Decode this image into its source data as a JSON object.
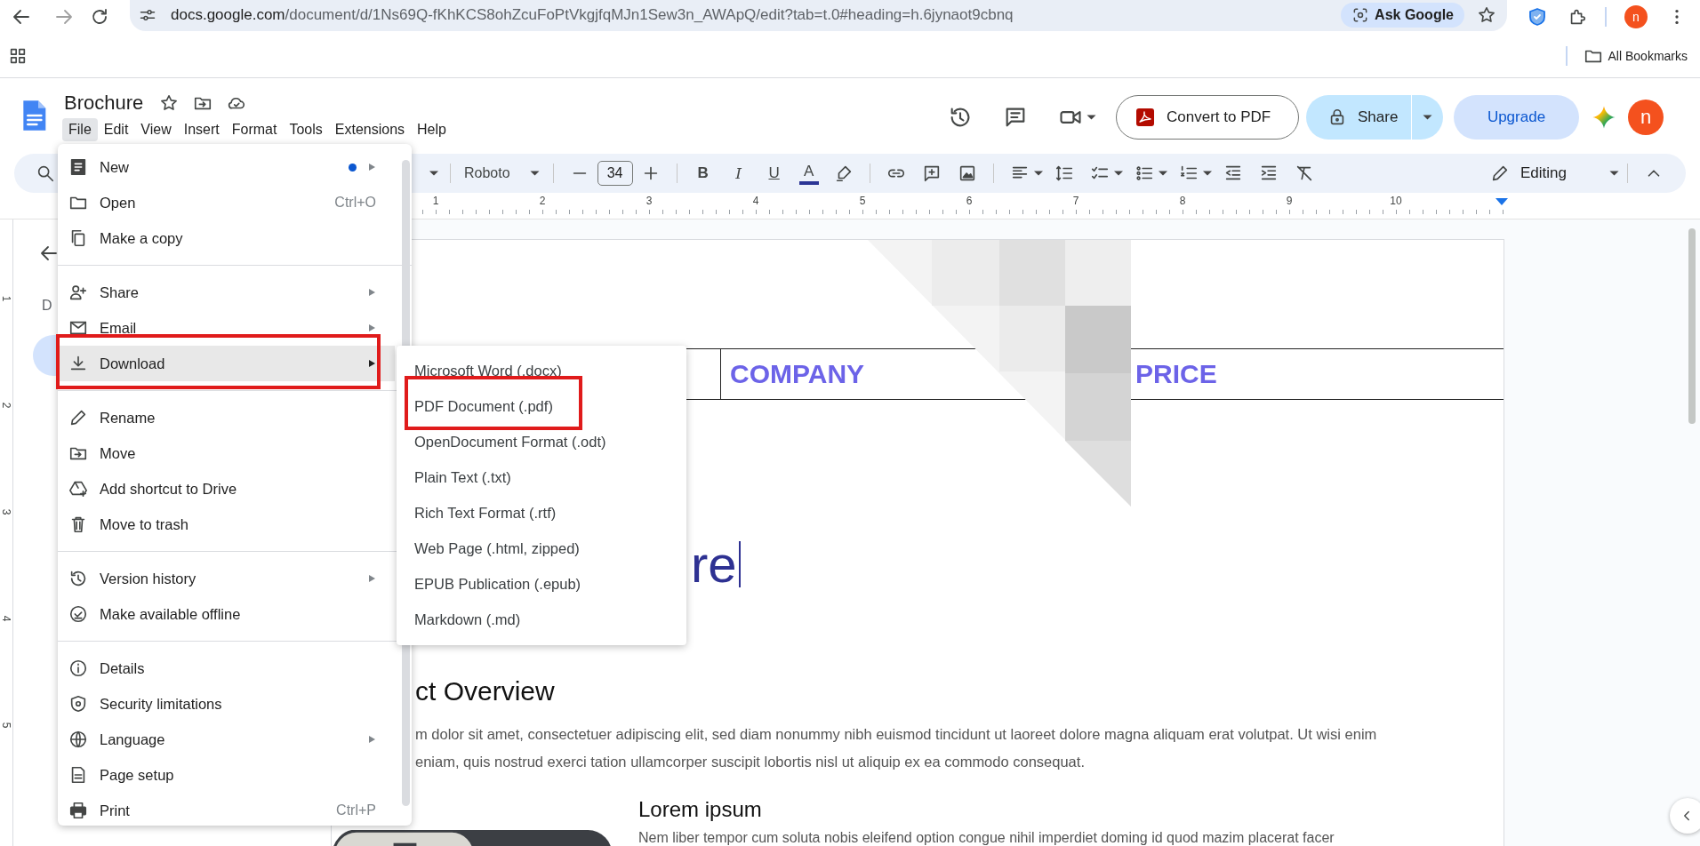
{
  "browser": {
    "address": {
      "host": "docs.google.com",
      "path": "/document/d/1Ns69Q-fKhKCS8ohZcuFoPtVkgjfqMJn1Sew3n_AWApQ/edit?tab=t.0#heading=h.6jynaot9cbnq"
    },
    "ask_google": "Ask Google",
    "profile": "n",
    "bookmarks": [
      {
        "label": "All Bookmarks"
      }
    ]
  },
  "doc": {
    "title": "Brochure",
    "menus": [
      {
        "label": "File",
        "selected": true
      },
      {
        "label": "Edit",
        "selected": false
      },
      {
        "label": "View",
        "selected": false
      },
      {
        "label": "Insert",
        "selected": false
      },
      {
        "label": "Format",
        "selected": false
      },
      {
        "label": "Tools",
        "selected": false
      },
      {
        "label": "Extensions",
        "selected": false
      },
      {
        "label": "Help",
        "selected": false
      }
    ],
    "convert_button": "Convert to PDF",
    "share_button": "Share",
    "upgrade_button": "Upgrade",
    "avatar": "n"
  },
  "toolbar": {
    "font": "Roboto",
    "font_size": "34",
    "format_buttons": [
      {
        "label": "B"
      },
      {
        "label": "I"
      },
      {
        "label": "U"
      },
      {
        "label": "A"
      }
    ],
    "mode": "Editing"
  },
  "ruler": {
    "numbers": [
      "1",
      "2",
      "3",
      "4",
      "5",
      "6",
      "7",
      "8",
      "9",
      "10"
    ]
  },
  "vertical_ruler": {
    "numbers": [
      "1",
      "2",
      "3",
      "4",
      "5"
    ]
  },
  "outline": {
    "letter": "D"
  },
  "file_menu": {
    "items": [
      {
        "kind": "item",
        "label": "New",
        "submenu": true,
        "dot": true,
        "selected": false,
        "highlighted": false
      },
      {
        "kind": "item",
        "label": "Open",
        "shortcut": "Ctrl+O",
        "submenu": false,
        "dot": false,
        "selected": false,
        "highlighted": false
      },
      {
        "kind": "item",
        "label": "Make a copy",
        "submenu": false,
        "dot": false,
        "selected": false,
        "highlighted": false
      },
      {
        "kind": "divider"
      },
      {
        "kind": "item",
        "label": "Share",
        "submenu": true,
        "dot": false,
        "selected": false,
        "highlighted": false
      },
      {
        "kind": "item",
        "label": "Email",
        "submenu": true,
        "dot": false,
        "selected": false,
        "highlighted": false
      },
      {
        "kind": "item",
        "label": "Download",
        "submenu": true,
        "dot": false,
        "selected": true,
        "highlighted": true
      },
      {
        "kind": "divider"
      },
      {
        "kind": "item",
        "label": "Rename",
        "submenu": false,
        "dot": false,
        "selected": false,
        "highlighted": false
      },
      {
        "kind": "item",
        "label": "Move",
        "submenu": false,
        "dot": false,
        "selected": false,
        "highlighted": false
      },
      {
        "kind": "item",
        "label": "Add shortcut to Drive",
        "submenu": false,
        "dot": false,
        "selected": false,
        "highlighted": false
      },
      {
        "kind": "item",
        "label": "Move to trash",
        "submenu": false,
        "dot": false,
        "selected": false,
        "highlighted": false
      },
      {
        "kind": "divider"
      },
      {
        "kind": "item",
        "label": "Version history",
        "submenu": true,
        "dot": false,
        "selected": false,
        "highlighted": false
      },
      {
        "kind": "item",
        "label": "Make available offline",
        "submenu": false,
        "dot": false,
        "selected": false,
        "highlighted": false
      },
      {
        "kind": "divider"
      },
      {
        "kind": "item",
        "label": "Details",
        "submenu": false,
        "dot": false,
        "selected": false,
        "highlighted": false
      },
      {
        "kind": "item",
        "label": "Security limitations",
        "submenu": false,
        "dot": false,
        "selected": false,
        "highlighted": false
      },
      {
        "kind": "item",
        "label": "Language",
        "submenu": true,
        "dot": false,
        "selected": false,
        "highlighted": false
      },
      {
        "kind": "item",
        "label": "Page setup",
        "submenu": false,
        "dot": false,
        "selected": false,
        "highlighted": false
      },
      {
        "kind": "item",
        "label": "Print",
        "shortcut": "Ctrl+P",
        "submenu": false,
        "dot": false,
        "selected": false,
        "highlighted": false
      }
    ]
  },
  "download_menu": {
    "items": [
      {
        "label": "Microsoft Word (.docx)",
        "highlighted": false
      },
      {
        "label": "PDF Document (.pdf)",
        "highlighted": true
      },
      {
        "label": "OpenDocument Format (.odt)",
        "highlighted": false
      },
      {
        "label": "Plain Text (.txt)",
        "highlighted": false
      },
      {
        "label": "Rich Text Format (.rtf)",
        "highlighted": false
      },
      {
        "label": "Web Page (.html, zipped)",
        "highlighted": false
      },
      {
        "label": "EPUB Publication (.epub)",
        "highlighted": false
      },
      {
        "label": "Markdown (.md)",
        "highlighted": false
      }
    ]
  },
  "document": {
    "table_headers": [
      "COMPANY",
      "PRICE"
    ],
    "title_fragment": "re",
    "heading": "ct Overview",
    "paragraph_lines": [
      "m dolor sit amet, consectetuer adipiscing elit, sed diam nonummy nibh euismod tincidunt ut laoreet dolore magna aliquam erat volutpat. Ut wisi enim",
      "eniam, quis nostrud exerci tation ullamcorper suscipit lobortis nisl ut aliquip ex ea commodo consequat."
    ],
    "subheading": "Lorem ipsum",
    "cut_line": "Nem liber tempor cum soluta nobis eleifend option congue nihil imperdiet doming id quod mazim placerat facer"
  }
}
